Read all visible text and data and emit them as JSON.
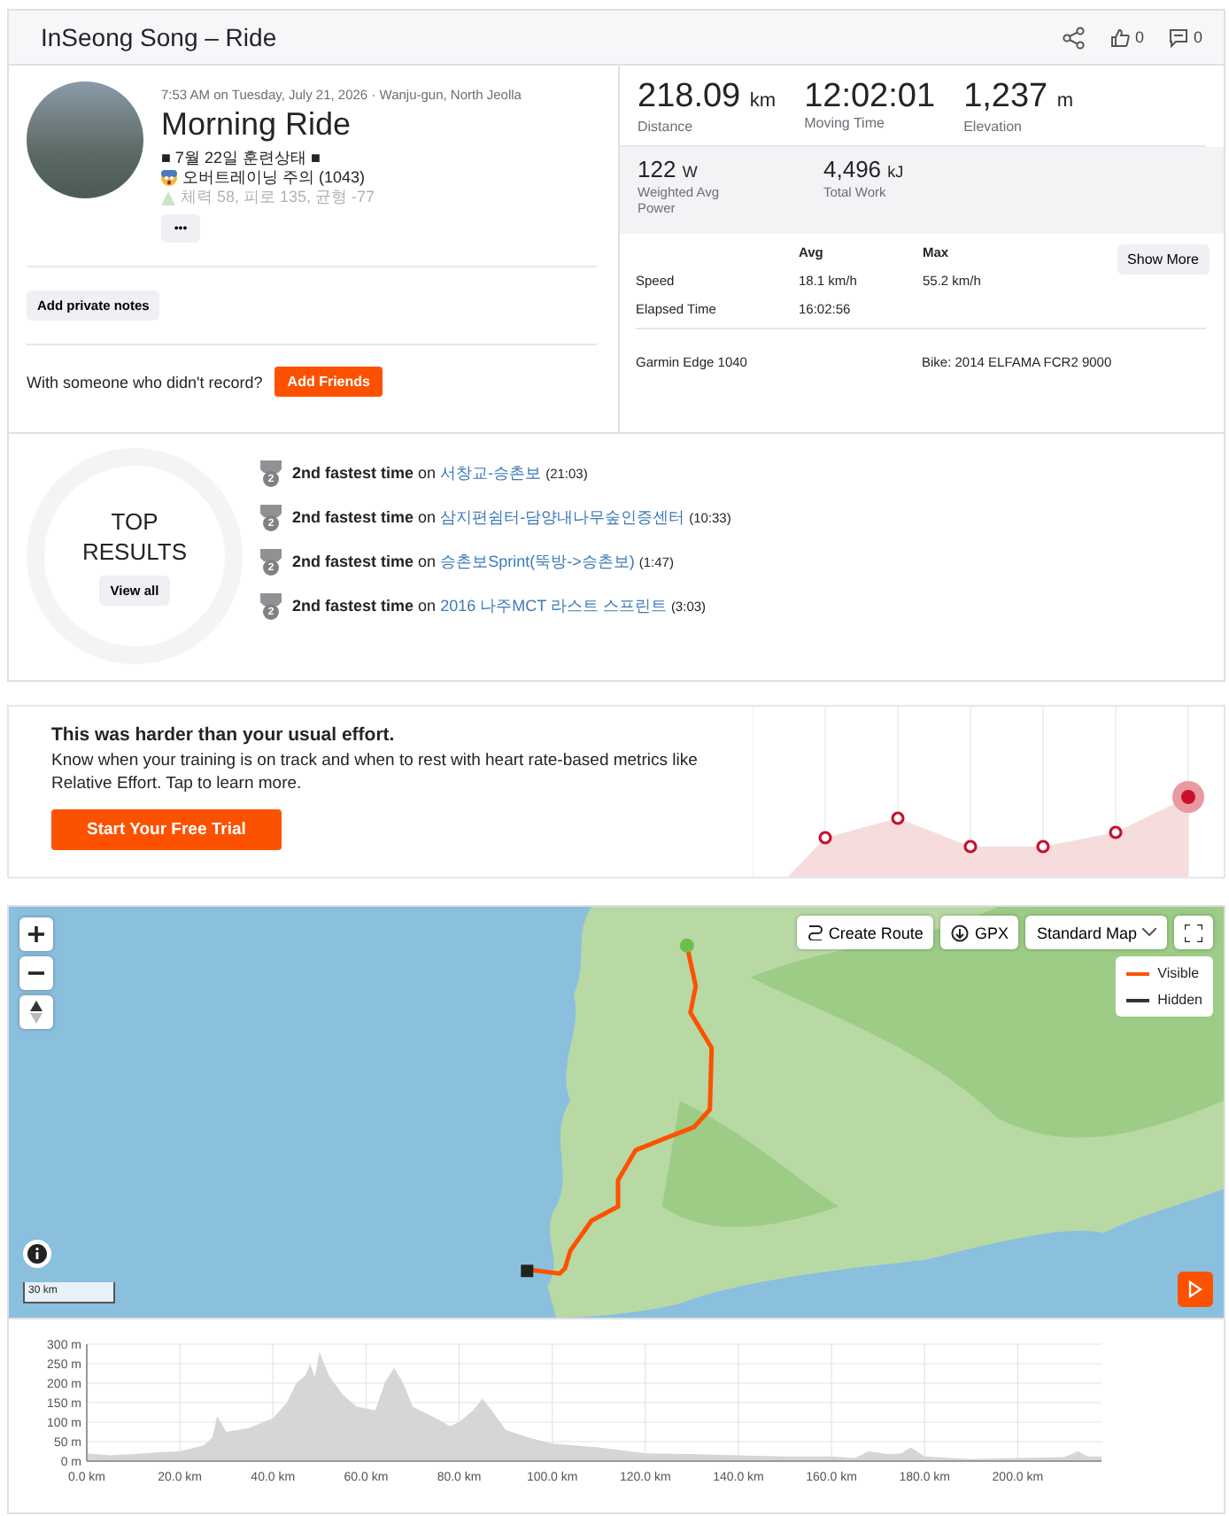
{
  "header": {
    "title": "InSeong Song – Ride",
    "kudos": "0",
    "comments": "0"
  },
  "activity": {
    "meta": "7:53 AM on Tuesday, July 21, 2026 · Wanju-gun, North Jeolla",
    "name": "Morning Ride",
    "description": [
      {
        "kind": "plain",
        "text": "■ 7월 22일 훈련상태 ■"
      },
      {
        "kind": "alert",
        "text": "오버트레이닝 주의 (1043)"
      },
      {
        "kind": "faded",
        "text": "체력 58, 피로 135, 균형 -77"
      }
    ],
    "more": "•••",
    "private_notes": "Add private notes",
    "friends_prompt": "With someone who didn't record?",
    "add_friends": "Add Friends"
  },
  "stats": {
    "primary": [
      {
        "value": "218.09",
        "unit": "km",
        "label": "Distance"
      },
      {
        "value": "12:02:01",
        "label": "Moving Time"
      },
      {
        "value": "1,237",
        "unit": "m",
        "label": "Elevation"
      }
    ],
    "secondary": [
      {
        "value": "122",
        "unit": "W",
        "label": "Weighted Avg Power"
      },
      {
        "value": "4,496",
        "unit": "kJ",
        "label": "Total Work"
      }
    ],
    "columns": [
      "Avg",
      "Max"
    ],
    "rows": [
      {
        "label": "Speed",
        "avg": "18.1 km/h",
        "max": "55.2 km/h"
      },
      {
        "label": "Elapsed Time",
        "avg": "16:02:56"
      }
    ],
    "show_more": "Show More",
    "device": "Garmin Edge 1040",
    "bike": "Bike: 2014 ELFAMA FCR2 9000"
  },
  "top_results": {
    "title": "TOP RESULTS",
    "view_all": "View all",
    "items": [
      {
        "rank": "2",
        "text": "**2nd fastest time** on",
        "segment": "서창교-승촌보",
        "time": "(21:03)"
      },
      {
        "rank": "2",
        "text": "**2nd fastest time** on",
        "segment": "삼지편쉼터-담양내나무숲인증센터",
        "time": "(10:33)"
      },
      {
        "rank": "2",
        "text": "**2nd fastest time** on",
        "segment": "승촌보Sprint(뚝방->승촌보)",
        "time": "(1:47)"
      },
      {
        "rank": "2",
        "text": "**2nd fastest time** on",
        "segment": "2016 나주MCT 라스트 스프린트",
        "time": "(3:03)"
      }
    ]
  },
  "effort": {
    "title": "This was harder than your usual effort.",
    "body": "Know when your training is on track and when to rest with heart rate-based metrics like Relative Effort. Tap to learn more.",
    "button": "Start Your Free Trial"
  },
  "map": {
    "create_route": "Create Route",
    "gpx": "GPX",
    "map_type": "Standard Map",
    "scale": "30 km",
    "legend": [
      {
        "label": "Visible",
        "color": "#fc5200"
      },
      {
        "label": "Hidden",
        "color": "#333333"
      }
    ]
  },
  "elevation": {
    "chart_data": {
      "type": "area",
      "xlim": [
        0,
        218
      ],
      "ylim": [
        0,
        300
      ],
      "xticks": [
        {
          "value": 0,
          "label": "0.0 km"
        },
        {
          "value": 20,
          "label": "20.0 km"
        },
        {
          "value": 40,
          "label": "40.0 km"
        },
        {
          "value": 60,
          "label": "60.0 km"
        },
        {
          "value": 80,
          "label": "80.0 km"
        },
        {
          "value": 100,
          "label": "100.0 km"
        },
        {
          "value": 120,
          "label": "120.0 km"
        },
        {
          "value": 140,
          "label": "140.0 km"
        },
        {
          "value": 160,
          "label": "160.0 km"
        },
        {
          "value": 180,
          "label": "180.0 km"
        },
        {
          "value": 200,
          "label": "200.0 km"
        }
      ],
      "yticks": [
        {
          "value": 0,
          "label": "0 m"
        },
        {
          "value": 50,
          "label": "50 m"
        },
        {
          "value": 100,
          "label": "100 m"
        },
        {
          "value": 150,
          "label": "150 m"
        },
        {
          "value": 200,
          "label": "200 m"
        },
        {
          "value": 250,
          "label": "250 m"
        },
        {
          "value": 300,
          "label": "300 m"
        }
      ],
      "x": [
        0,
        5,
        10,
        15,
        20,
        25,
        27,
        28,
        30,
        35,
        40,
        43,
        45,
        47,
        48,
        49,
        50,
        52,
        55,
        58,
        60,
        62,
        64,
        66,
        68,
        70,
        75,
        78,
        80,
        83,
        85,
        87,
        90,
        95,
        100,
        110,
        120,
        130,
        140,
        150,
        160,
        165,
        168,
        172,
        175,
        177,
        180,
        190,
        200,
        210,
        213,
        215,
        218
      ],
      "grid": true,
      "values": [
        20,
        15,
        18,
        22,
        25,
        40,
        60,
        115,
        75,
        85,
        110,
        150,
        200,
        220,
        250,
        215,
        280,
        220,
        170,
        140,
        135,
        130,
        200,
        240,
        200,
        140,
        110,
        90,
        100,
        130,
        160,
        130,
        80,
        60,
        45,
        35,
        20,
        18,
        15,
        12,
        12,
        8,
        25,
        18,
        20,
        35,
        12,
        5,
        8,
        10,
        25,
        12,
        12
      ]
    }
  }
}
